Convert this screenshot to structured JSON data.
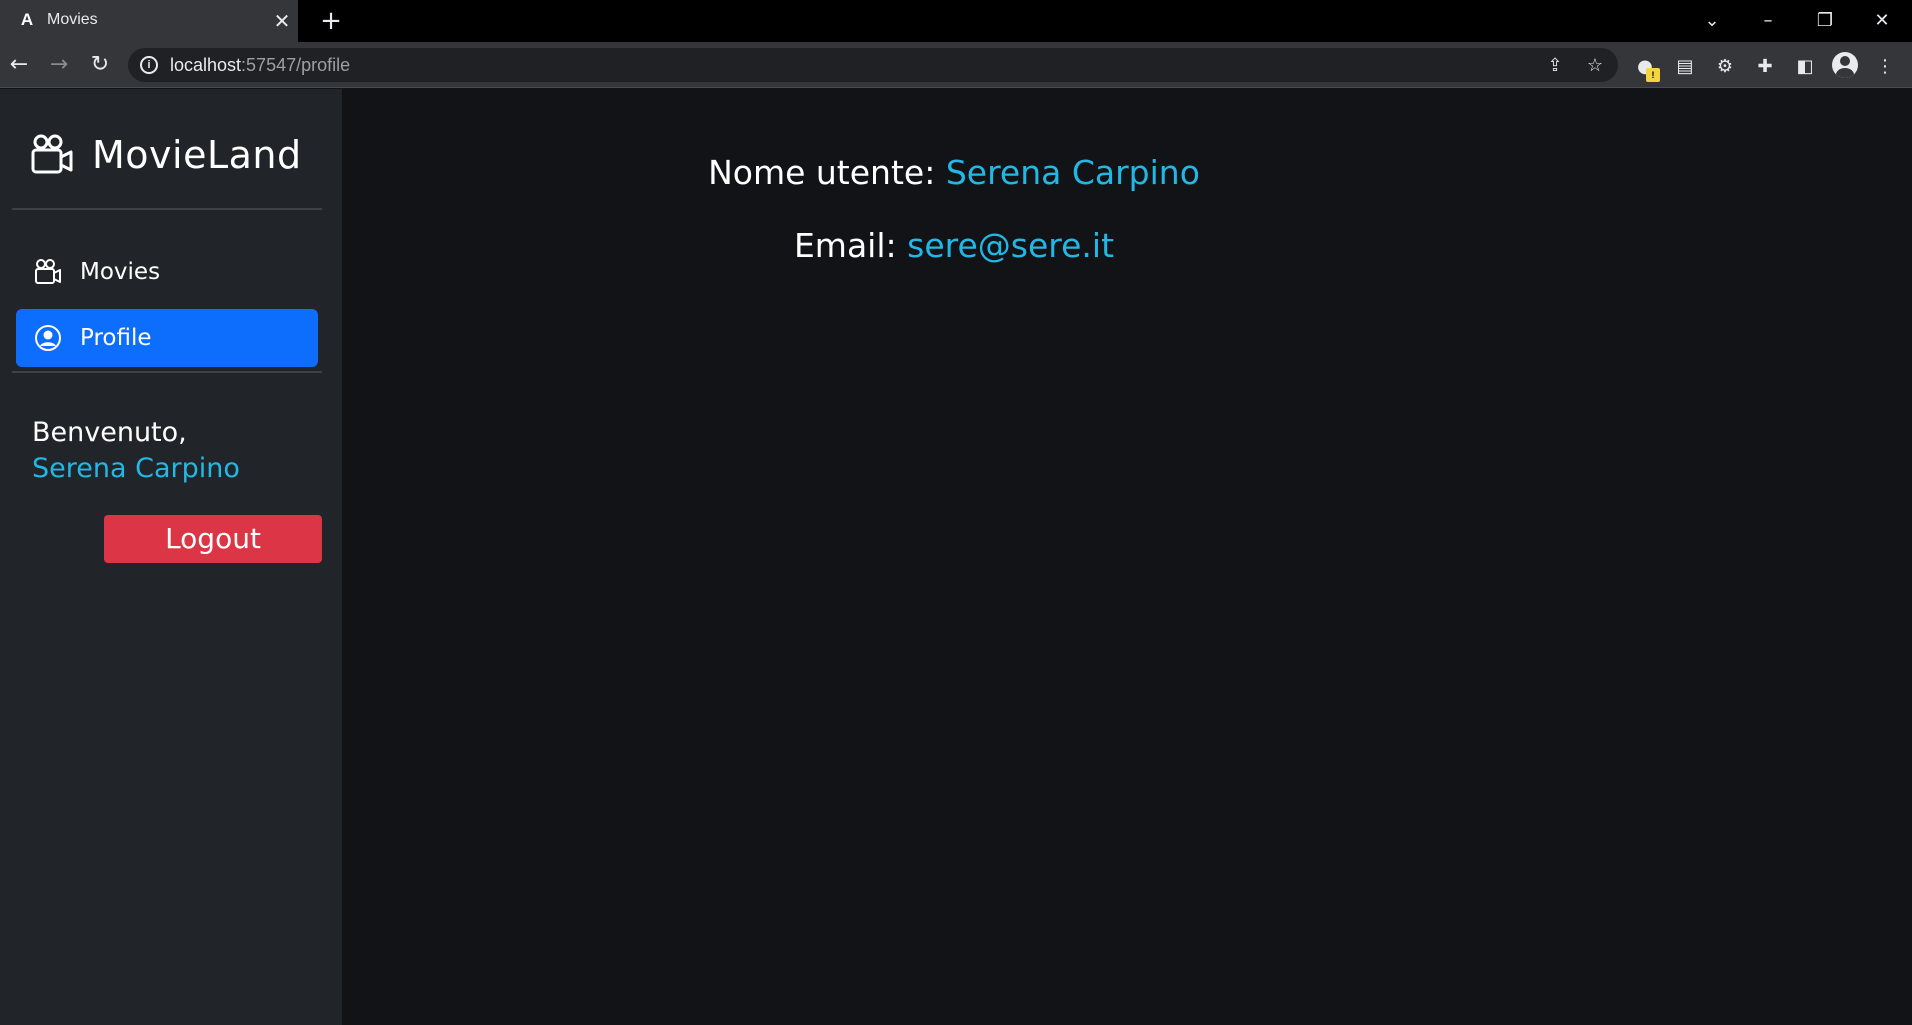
{
  "browser": {
    "tab_title": "Movies",
    "tab_favicon": "A",
    "url_host": "localhost",
    "url_path": ":57547/profile",
    "icons": [
      "back-icon",
      "forward-icon",
      "reload-icon",
      "info-icon",
      "share-icon",
      "star-icon",
      "extension-icon",
      "puzzle-icon",
      "sidepanel-icon",
      "profile-icon",
      "menu-icon"
    ]
  },
  "sidebar": {
    "brand": "MovieLand",
    "nav": [
      {
        "label": "Movies",
        "icon": "video-camera-icon",
        "active": false
      },
      {
        "label": "Profile",
        "icon": "user-circle-icon",
        "active": true
      }
    ],
    "welcome_label": "Benvenuto,",
    "welcome_user": "Serena Carpino",
    "logout_label": "Logout"
  },
  "profile": {
    "name_label": "Nome utente:",
    "name_value": "Serena Carpino",
    "email_label": "Email:",
    "email_value": "sere@sere.it"
  },
  "colors": {
    "accent_text": "#22b8e6",
    "active_nav": "#0d6efd",
    "logout": "#dc3545",
    "sidebar_bg": "#212529",
    "main_bg": "#121316"
  }
}
